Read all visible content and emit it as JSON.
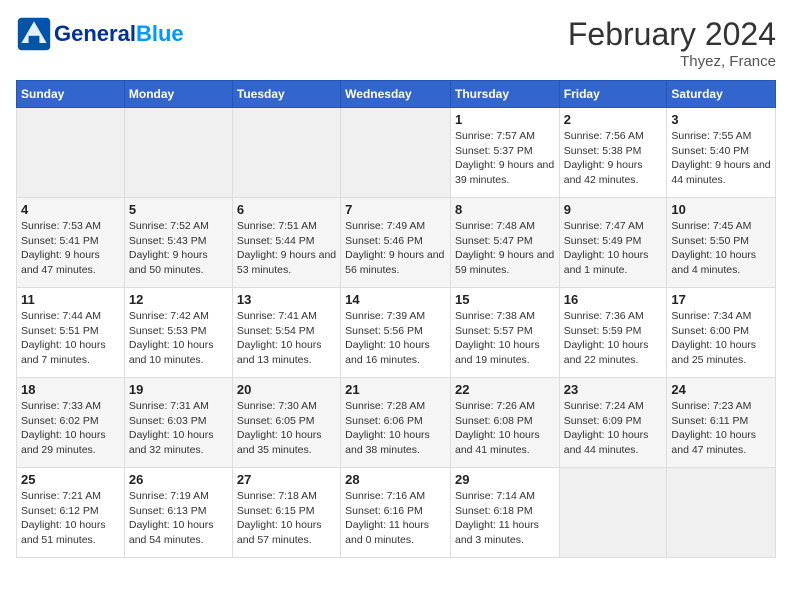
{
  "logo": {
    "part1": "General",
    "part2": "Blue"
  },
  "title": "February 2024",
  "subtitle": "Thyez, France",
  "weekdays": [
    "Sunday",
    "Monday",
    "Tuesday",
    "Wednesday",
    "Thursday",
    "Friday",
    "Saturday"
  ],
  "weeks": [
    [
      {
        "day": "",
        "empty": true
      },
      {
        "day": "",
        "empty": true
      },
      {
        "day": "",
        "empty": true
      },
      {
        "day": "",
        "empty": true
      },
      {
        "day": "1",
        "sunrise": "7:57 AM",
        "sunset": "5:37 PM",
        "daylight": "9 hours and 39 minutes."
      },
      {
        "day": "2",
        "sunrise": "7:56 AM",
        "sunset": "5:38 PM",
        "daylight": "9 hours and 42 minutes."
      },
      {
        "day": "3",
        "sunrise": "7:55 AM",
        "sunset": "5:40 PM",
        "daylight": "9 hours and 44 minutes."
      }
    ],
    [
      {
        "day": "4",
        "sunrise": "7:53 AM",
        "sunset": "5:41 PM",
        "daylight": "9 hours and 47 minutes."
      },
      {
        "day": "5",
        "sunrise": "7:52 AM",
        "sunset": "5:43 PM",
        "daylight": "9 hours and 50 minutes."
      },
      {
        "day": "6",
        "sunrise": "7:51 AM",
        "sunset": "5:44 PM",
        "daylight": "9 hours and 53 minutes."
      },
      {
        "day": "7",
        "sunrise": "7:49 AM",
        "sunset": "5:46 PM",
        "daylight": "9 hours and 56 minutes."
      },
      {
        "day": "8",
        "sunrise": "7:48 AM",
        "sunset": "5:47 PM",
        "daylight": "9 hours and 59 minutes."
      },
      {
        "day": "9",
        "sunrise": "7:47 AM",
        "sunset": "5:49 PM",
        "daylight": "10 hours and 1 minute."
      },
      {
        "day": "10",
        "sunrise": "7:45 AM",
        "sunset": "5:50 PM",
        "daylight": "10 hours and 4 minutes."
      }
    ],
    [
      {
        "day": "11",
        "sunrise": "7:44 AM",
        "sunset": "5:51 PM",
        "daylight": "10 hours and 7 minutes."
      },
      {
        "day": "12",
        "sunrise": "7:42 AM",
        "sunset": "5:53 PM",
        "daylight": "10 hours and 10 minutes."
      },
      {
        "day": "13",
        "sunrise": "7:41 AM",
        "sunset": "5:54 PM",
        "daylight": "10 hours and 13 minutes."
      },
      {
        "day": "14",
        "sunrise": "7:39 AM",
        "sunset": "5:56 PM",
        "daylight": "10 hours and 16 minutes."
      },
      {
        "day": "15",
        "sunrise": "7:38 AM",
        "sunset": "5:57 PM",
        "daylight": "10 hours and 19 minutes."
      },
      {
        "day": "16",
        "sunrise": "7:36 AM",
        "sunset": "5:59 PM",
        "daylight": "10 hours and 22 minutes."
      },
      {
        "day": "17",
        "sunrise": "7:34 AM",
        "sunset": "6:00 PM",
        "daylight": "10 hours and 25 minutes."
      }
    ],
    [
      {
        "day": "18",
        "sunrise": "7:33 AM",
        "sunset": "6:02 PM",
        "daylight": "10 hours and 29 minutes."
      },
      {
        "day": "19",
        "sunrise": "7:31 AM",
        "sunset": "6:03 PM",
        "daylight": "10 hours and 32 minutes."
      },
      {
        "day": "20",
        "sunrise": "7:30 AM",
        "sunset": "6:05 PM",
        "daylight": "10 hours and 35 minutes."
      },
      {
        "day": "21",
        "sunrise": "7:28 AM",
        "sunset": "6:06 PM",
        "daylight": "10 hours and 38 minutes."
      },
      {
        "day": "22",
        "sunrise": "7:26 AM",
        "sunset": "6:08 PM",
        "daylight": "10 hours and 41 minutes."
      },
      {
        "day": "23",
        "sunrise": "7:24 AM",
        "sunset": "6:09 PM",
        "daylight": "10 hours and 44 minutes."
      },
      {
        "day": "24",
        "sunrise": "7:23 AM",
        "sunset": "6:11 PM",
        "daylight": "10 hours and 47 minutes."
      }
    ],
    [
      {
        "day": "25",
        "sunrise": "7:21 AM",
        "sunset": "6:12 PM",
        "daylight": "10 hours and 51 minutes."
      },
      {
        "day": "26",
        "sunrise": "7:19 AM",
        "sunset": "6:13 PM",
        "daylight": "10 hours and 54 minutes."
      },
      {
        "day": "27",
        "sunrise": "7:18 AM",
        "sunset": "6:15 PM",
        "daylight": "10 hours and 57 minutes."
      },
      {
        "day": "28",
        "sunrise": "7:16 AM",
        "sunset": "6:16 PM",
        "daylight": "11 hours and 0 minutes."
      },
      {
        "day": "29",
        "sunrise": "7:14 AM",
        "sunset": "6:18 PM",
        "daylight": "11 hours and 3 minutes."
      },
      {
        "day": "",
        "empty": true
      },
      {
        "day": "",
        "empty": true
      }
    ]
  ]
}
